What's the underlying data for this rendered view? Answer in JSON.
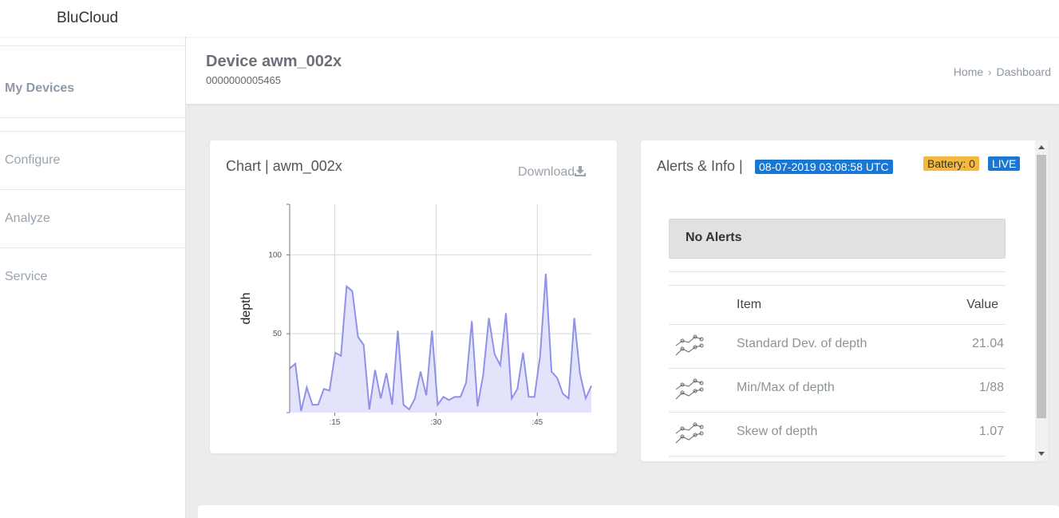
{
  "app": {
    "brand": "BluCloud"
  },
  "sidebar": {
    "items": [
      {
        "label": "My Devices",
        "active": true
      },
      {
        "label": "Configure"
      },
      {
        "label": "Analyze"
      },
      {
        "label": "Service"
      }
    ]
  },
  "header": {
    "title": "Device awm_002x",
    "device_id": "0000000005465",
    "breadcrumb": [
      "Home",
      "Dashboard"
    ]
  },
  "chart_card": {
    "title": "Chart | awm_002x",
    "download_label": "Download",
    "download_icon": "download-icon"
  },
  "chart_data": {
    "type": "area",
    "ylabel": "depth",
    "xlabel": "",
    "x_ticks": [
      ":15",
      ":30",
      ":45"
    ],
    "y_ticks": [
      "50",
      "100"
    ],
    "ylim": [
      0,
      132
    ],
    "xlim": [
      0,
      67
    ],
    "grid": true,
    "series_color": "#8f92e8",
    "x": [
      0,
      1,
      2,
      3,
      4,
      5,
      6,
      7,
      8,
      9,
      10,
      11,
      12,
      13,
      14,
      15,
      16,
      17,
      18,
      19,
      20,
      21,
      22,
      22.5,
      23,
      24,
      25,
      26,
      26.5,
      27,
      28,
      28.5,
      29,
      30,
      31,
      32,
      33,
      34,
      35,
      36,
      37,
      38,
      39,
      40,
      41,
      42,
      43,
      44,
      45,
      46,
      47,
      48,
      49,
      50,
      51,
      52,
      53,
      54,
      55,
      56,
      57,
      58,
      59,
      60,
      61,
      62,
      63,
      64,
      65,
      66,
      67
    ],
    "y": [
      28,
      31,
      1,
      16,
      5,
      5,
      15,
      14,
      38,
      36,
      80,
      77,
      48,
      43,
      2,
      27,
      9,
      25,
      5,
      52,
      5,
      2,
      9,
      26,
      11,
      52,
      5,
      10,
      8,
      10,
      10,
      19,
      58,
      4,
      24,
      60,
      37,
      30,
      63,
      9,
      15,
      38,
      10,
      10,
      36,
      88,
      26,
      22,
      12,
      9,
      60,
      25,
      9,
      17
    ]
  },
  "alerts_card": {
    "title": "Alerts & Info |",
    "timestamp": "08-07-2019 03:08:58 UTC",
    "battery": "Battery: 0",
    "live": "LIVE",
    "no_alerts": "No Alerts",
    "table": {
      "headers": [
        "Item",
        "Value"
      ],
      "rows": [
        {
          "icon": "trend-line-icon",
          "item": "Standard Dev. of depth",
          "value": "21.04"
        },
        {
          "icon": "trend-line-icon",
          "item": "Min/Max of depth",
          "value": "1/88"
        },
        {
          "icon": "trend-line-icon",
          "item": "Skew of depth",
          "value": "1.07"
        }
      ]
    }
  },
  "colors": {
    "accent_blue": "#1976d2",
    "battery_badge": "#f5b940",
    "background": "#ececec"
  }
}
